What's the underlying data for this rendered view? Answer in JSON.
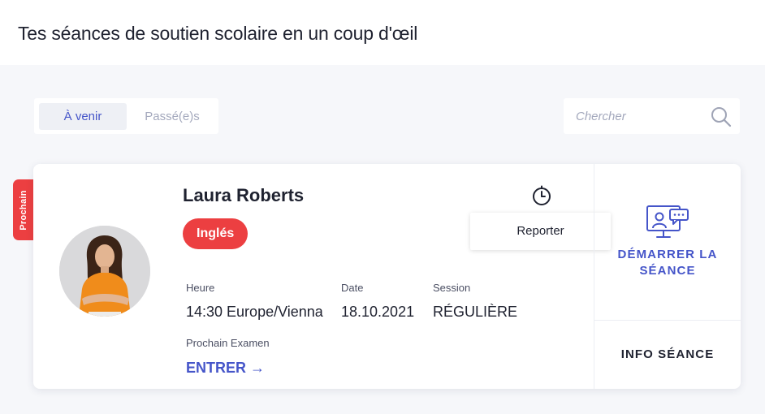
{
  "header": {
    "title": "Tes séances de soutien scolaire en un coup d'œil"
  },
  "tabs": [
    {
      "label": "À venir",
      "active": true
    },
    {
      "label": "Passé(e)s",
      "active": false
    }
  ],
  "search": {
    "placeholder": "Chercher",
    "value": "",
    "icon": "search-icon"
  },
  "session": {
    "badge": "Prochain",
    "tutor_name": "Laura Roberts",
    "subject": "Inglés",
    "reporter_label": "Reporter",
    "fields": {
      "time": {
        "label": "Heure",
        "value": "14:30 Europe/Vienna"
      },
      "date": {
        "label": "Date",
        "value": "18.10.2021"
      },
      "session_type": {
        "label": "Session",
        "value": "RÉGULIÈRE"
      },
      "next_exam": {
        "label": "Prochain Examen",
        "link": "ENTRER →"
      }
    },
    "start_label_line1": "DÉMARRER LA",
    "start_label_line2": "SÉANCE",
    "info_label": "INFO SÉANCE"
  },
  "colors": {
    "accent": "#4555c9",
    "danger": "#ec3f41",
    "background": "#f6f7fa"
  }
}
